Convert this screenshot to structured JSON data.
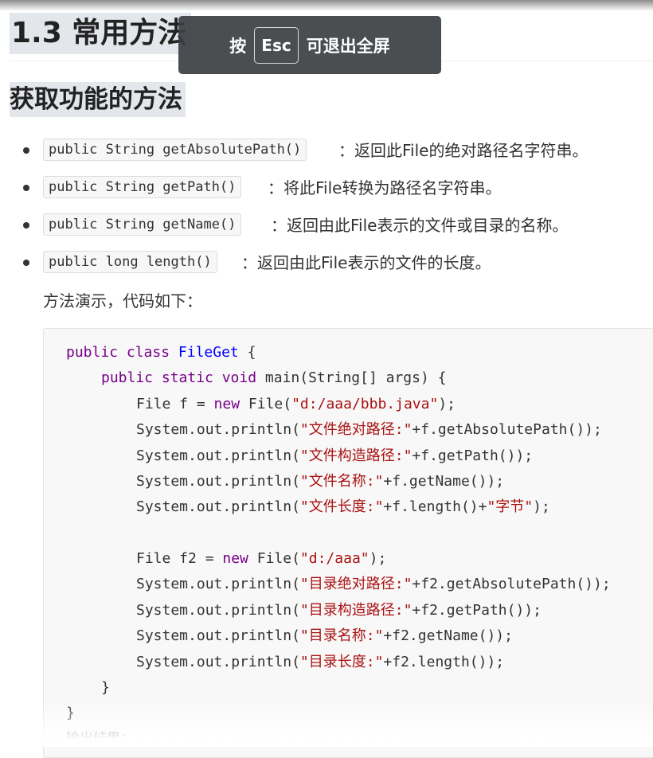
{
  "headings": {
    "section": "1.3 常用方法",
    "subsection": "获取功能的方法"
  },
  "methods": [
    {
      "signature": "public String getAbsolutePath()",
      "description": "：返回此File的绝对路径名字符串。"
    },
    {
      "signature": "public String getPath()",
      "description": "：将此File转换为路径名字符串。"
    },
    {
      "signature": "public String getName()",
      "description": "：返回由此File表示的文件或目录的名称。"
    },
    {
      "signature": "public long length()",
      "description": "：返回由此File表示的文件的长度。"
    }
  ],
  "intro_text": "方法演示，代码如下：",
  "code": {
    "l1": {
      "kw": "public class ",
      "def": "FileGet",
      "rest": " {"
    },
    "l2": {
      "kw": "public static void ",
      "rest": "main(String[] args) {"
    },
    "l3": {
      "a": "File f = ",
      "kw": "new",
      "b": " File(",
      "str": "\"d:/aaa/bbb.java\"",
      "c": ");"
    },
    "l4": {
      "a": "System.out.println(",
      "str": "\"文件绝对路径:\"",
      "c": "+f.getAbsolutePath());"
    },
    "l5": {
      "a": "System.out.println(",
      "str": "\"文件构造路径:\"",
      "c": "+f.getPath());"
    },
    "l6": {
      "a": "System.out.println(",
      "str": "\"文件名称:\"",
      "c": "+f.getName());"
    },
    "l7": {
      "a": "System.out.println(",
      "str": "\"文件长度:\"",
      "b": "+f.length()+",
      "str2": "\"字节\"",
      "c": ");"
    },
    "l8": {
      "a": "File f2 = ",
      "kw": "new",
      "b": " File(",
      "str": "\"d:/aaa\"",
      "c": ");"
    },
    "l9": {
      "a": "System.out.println(",
      "str": "\"目录绝对路径:\"",
      "c": "+f2.getAbsolutePath());"
    },
    "l10": {
      "a": "System.out.println(",
      "str": "\"目录构造路径:\"",
      "c": "+f2.getPath());"
    },
    "l11": {
      "a": "System.out.println(",
      "str": "\"目录名称:\"",
      "c": "+f2.getName());"
    },
    "l12": {
      "a": "System.out.println(",
      "str": "\"目录长度:\"",
      "c": "+f2.length());"
    },
    "l13": {
      "rest": "}"
    },
    "l14": {
      "rest": "}"
    }
  },
  "output_label": "输出结果：",
  "fullscreen_toast": {
    "prefix": "按",
    "key": "Esc",
    "suffix": "可退出全屏"
  }
}
